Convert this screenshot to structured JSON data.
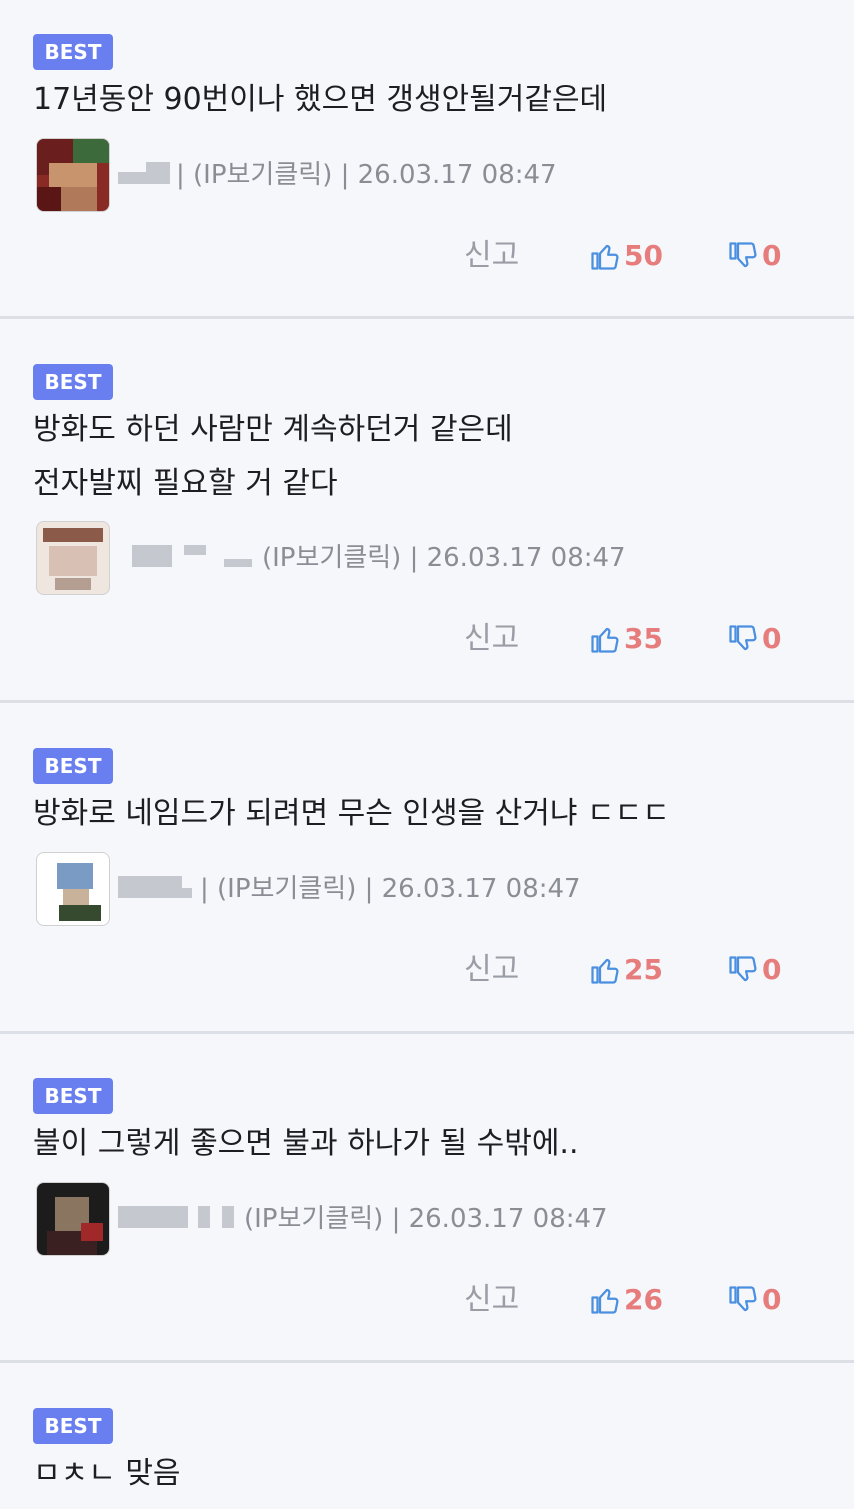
{
  "comments": [
    {
      "badge": "BEST",
      "lines": [
        "17년동안 90번이나 했으면 갱생안될거같은데"
      ],
      "meta": "| (IP보기클릭) | 26.03.17 08:47",
      "report": "신고",
      "likes": "50",
      "dislikes": "0"
    },
    {
      "badge": "BEST",
      "lines": [
        "방화도 하던 사람만 계속하던거 같은데",
        "전자발찌 필요할 거 같다"
      ],
      "meta": "(IP보기클릭) | 26.03.17 08:47",
      "report": "신고",
      "likes": "35",
      "dislikes": "0"
    },
    {
      "badge": "BEST",
      "lines": [
        "방화로 네임드가 되려면 무슨 인생을 산거냐 ㄷㄷㄷ"
      ],
      "meta": "| (IP보기클릭) | 26.03.17 08:47",
      "report": "신고",
      "likes": "25",
      "dislikes": "0"
    },
    {
      "badge": "BEST",
      "lines": [
        "불이 그렇게 좋으면 불과 하나가 될 수밖에.."
      ],
      "meta": "(IP보기클릭) | 26.03.17 08:47",
      "report": "신고",
      "likes": "26",
      "dislikes": "0"
    },
    {
      "badge": "BEST",
      "lines": [
        "ㅁㅊㄴ 맞음"
      ]
    }
  ],
  "icons": {
    "like": "thumbs-up-icon",
    "dislike": "thumbs-down-icon"
  },
  "colors": {
    "badge": "#6a7fef",
    "like_icon": "#4a8fe0",
    "vote_count": "#e67c7c"
  }
}
